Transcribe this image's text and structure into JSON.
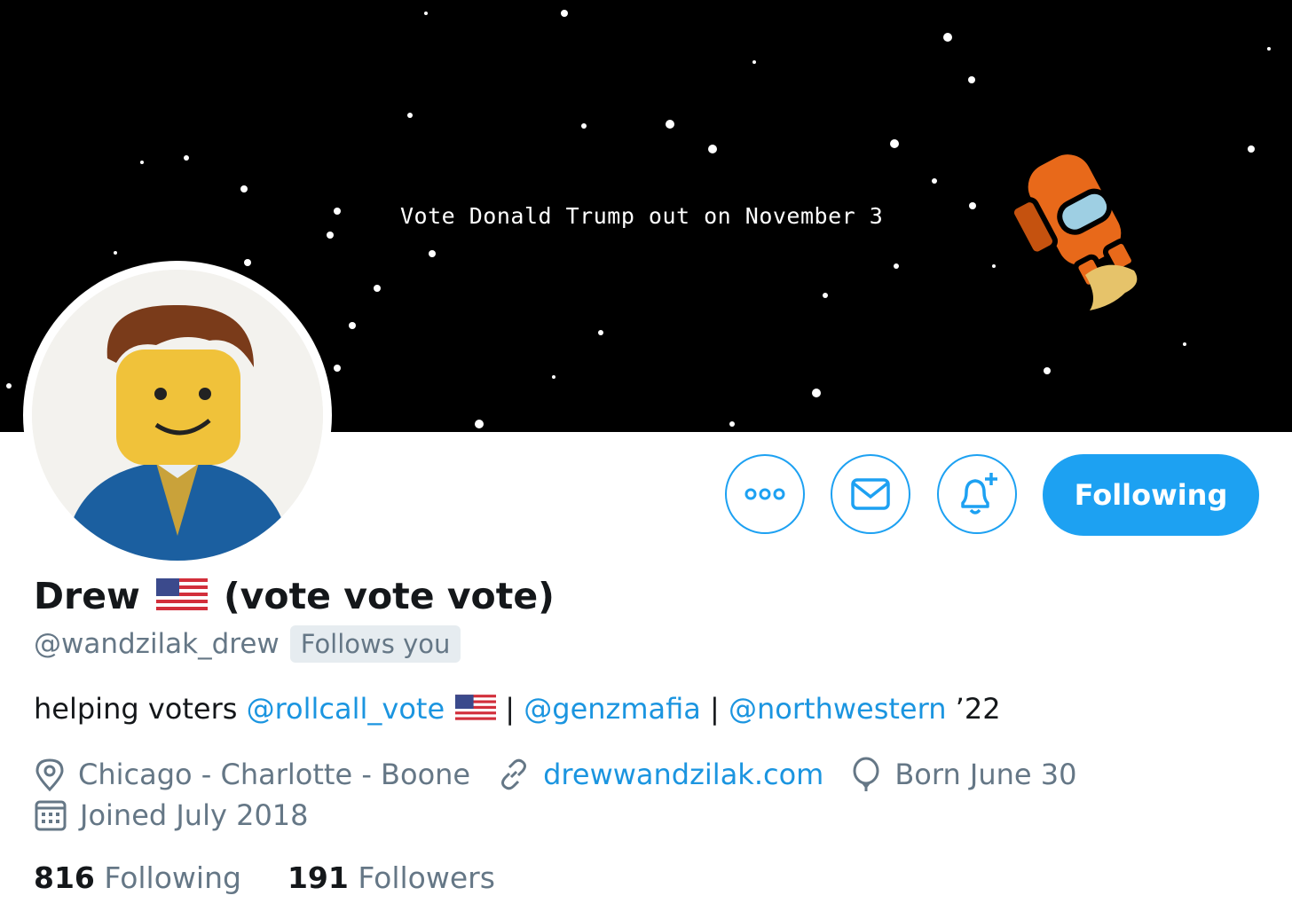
{
  "banner": {
    "text": "Vote Donald Trump out on November 3"
  },
  "actions": {
    "more_icon": "more-icon",
    "message_icon": "envelope-icon",
    "notify_icon": "bell-plus-icon",
    "following_label": "Following"
  },
  "profile": {
    "name": "Drew",
    "name_suffix": "(vote vote vote)",
    "handle": "@wandzilak_drew",
    "follows_you": "Follows you",
    "bio": {
      "prefix": "helping voters ",
      "mention1": "@rollcall_vote",
      "sep1": " | ",
      "mention2": "@genzmafia",
      "sep2": " | ",
      "mention3": "@northwestern",
      "suffix": " ’22"
    },
    "location": "Chicago - Charlotte - Boone",
    "website": "drewwandzilak.com",
    "birthday": "Born June 30",
    "joined": "Joined July 2018"
  },
  "stats": {
    "following_count": "816",
    "following_label": "Following",
    "followers_count": "191",
    "followers_label": "Followers"
  },
  "colors": {
    "accent": "#1da1f2",
    "link": "#1b95e0",
    "muted": "#657786"
  }
}
